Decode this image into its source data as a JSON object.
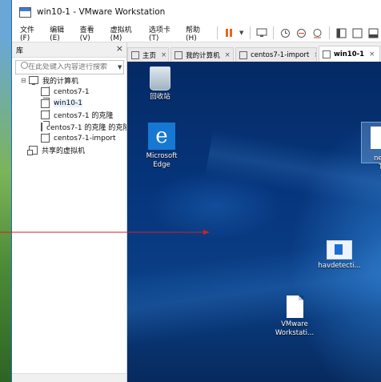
{
  "window": {
    "title": "win10-1 - VMware Workstation"
  },
  "menubar": {
    "items": [
      "文件(F)",
      "编辑(E)",
      "查看(V)",
      "虚拟机(M)",
      "选项卡(T)",
      "帮助(H)"
    ]
  },
  "toolbar": {
    "icons": [
      "pause-icon",
      "dropdown-icon",
      "send-keys-icon",
      "snapshot-icon",
      "snapshot-restore-icon",
      "snapshot-manager-icon",
      "console-view-icon",
      "library-view-icon",
      "thumbnail-view-icon"
    ]
  },
  "sidebar": {
    "header": "库",
    "search_placeholder": "在此处键入内容进行搜索",
    "tree": [
      {
        "label": "我的计算机",
        "level": 0,
        "icon": "computer-icon"
      },
      {
        "label": "centos7-1",
        "level": 1,
        "icon": "vm-icon"
      },
      {
        "label": "win10-1",
        "level": 1,
        "icon": "vm-icon",
        "selected": true
      },
      {
        "label": "centos7-1 的克隆",
        "level": 1,
        "icon": "vm-icon"
      },
      {
        "label": "centos7-1 的克隆 的克隆",
        "level": 1,
        "icon": "vm-icon"
      },
      {
        "label": "centos7-1-import",
        "level": 1,
        "icon": "vm-icon"
      },
      {
        "label": "共享的虚拟机",
        "level": 0,
        "icon": "shared-icon"
      }
    ]
  },
  "tabs": [
    {
      "label": "主页"
    },
    {
      "label": "我的计算机"
    },
    {
      "label": "centos7-1-import"
    },
    {
      "label": "win10-1",
      "active": true
    }
  ],
  "desktop": {
    "icons": [
      {
        "label": "回收站"
      },
      {
        "label": "Microsoft Edge"
      },
      {
        "label": "new T"
      },
      {
        "label": "havdetecti..."
      },
      {
        "label": "VMware Workstati..."
      }
    ]
  },
  "colors": {
    "accent": "#1e6fb8",
    "pause": "#e8661c",
    "arrow": "#d42020"
  }
}
